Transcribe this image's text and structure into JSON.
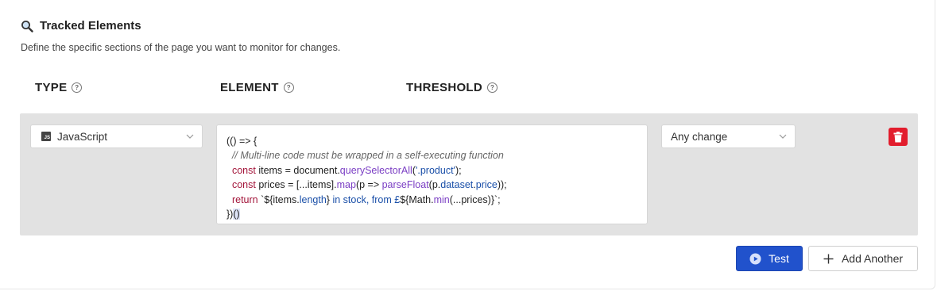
{
  "header": {
    "title": "Tracked Elements",
    "description": "Define the specific sections of the page you want to monitor for changes."
  },
  "columns": {
    "type": "TYPE",
    "element": "ELEMENT",
    "threshold": "THRESHOLD",
    "help_glyph": "?"
  },
  "row": {
    "type_value": "JavaScript",
    "type_badge": "JS",
    "threshold_value": "Any change"
  },
  "actions": {
    "test_label": "Test",
    "add_label": "Add Another"
  },
  "colors": {
    "primary": "#2152cc",
    "danger": "#e21d2d",
    "row_background": "#e2e2e2"
  },
  "icons": [
    "magnifier-icon",
    "help-icon",
    "js-file-icon",
    "chevron-down-icon",
    "trash-icon",
    "play-circle-icon",
    "plus-icon"
  ]
}
